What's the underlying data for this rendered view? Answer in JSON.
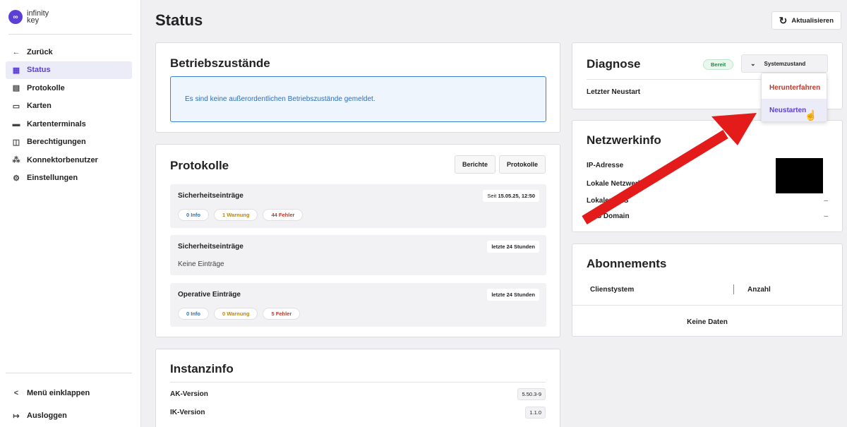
{
  "logo": {
    "line1": "infinity",
    "line2": "key"
  },
  "sidebar": {
    "items": [
      {
        "label": "Zurück",
        "icon": "←"
      },
      {
        "label": "Status",
        "icon": "▦"
      },
      {
        "label": "Protokolle",
        "icon": "▤"
      },
      {
        "label": "Karten",
        "icon": "▭"
      },
      {
        "label": "Kartenterminals",
        "icon": "▬"
      },
      {
        "label": "Berechtigungen",
        "icon": "◫"
      },
      {
        "label": "Konnektorbenutzer",
        "icon": "⁂"
      },
      {
        "label": "Einstellungen",
        "icon": "⚙"
      }
    ],
    "collapse": {
      "label": "Menü einklappen",
      "icon": "<"
    },
    "logout": {
      "label": "Ausloggen",
      "icon": "↦"
    }
  },
  "header": {
    "title": "Status",
    "refresh": "Aktualisieren"
  },
  "betrieb": {
    "title": "Betriebszustände",
    "message": "Es sind keine außerordentlichen Betriebszustände gemeldet."
  },
  "protokolle": {
    "title": "Protokolle",
    "btn_berichte": "Berichte",
    "btn_protokolle": "Protokolle",
    "entries": [
      {
        "title": "Sicherheitseinträge",
        "when_prefix": "Seit",
        "when": "15.05.25, 12:50",
        "info": "0 Info",
        "warn": "1 Warnung",
        "err": "44 Fehler"
      },
      {
        "title": "Sicherheitseinträge",
        "when": "letzte 24 Stunden",
        "empty": "Keine Einträge"
      },
      {
        "title": "Operative Einträge",
        "when": "letzte 24 Stunden",
        "info": "0 Info",
        "warn": "0 Warnung",
        "err": "5 Fehler"
      }
    ]
  },
  "instanz": {
    "title": "Instanzinfo",
    "ak_label": "AK-Version",
    "ak_value": "5.50.3-9",
    "ik_label": "IK-Version",
    "ik_value": "1.1.0"
  },
  "diagnose": {
    "title": "Diagnose",
    "badge": "Bereit",
    "button": "Systemzustand",
    "row": "Letzter Neustart"
  },
  "dropdown": {
    "shutdown": "Herunterfahren",
    "restart": "Neustarten"
  },
  "netzwerk": {
    "title": "Netzwerkinfo",
    "ip": "IP-Adresse",
    "lokal_netz": "Lokale Netzwerke",
    "lokal_dns": "Lokaler DNS",
    "dns_domain": "DNS Domain",
    "dash": "–"
  },
  "abo": {
    "title": "Abonnements",
    "col1": "Clienstystem",
    "col2": "Anzahl",
    "empty": "Keine Daten"
  },
  "colors": {
    "accent": "#5b3fd6",
    "danger": "#c0392b",
    "arrow": "#e31b1b"
  }
}
